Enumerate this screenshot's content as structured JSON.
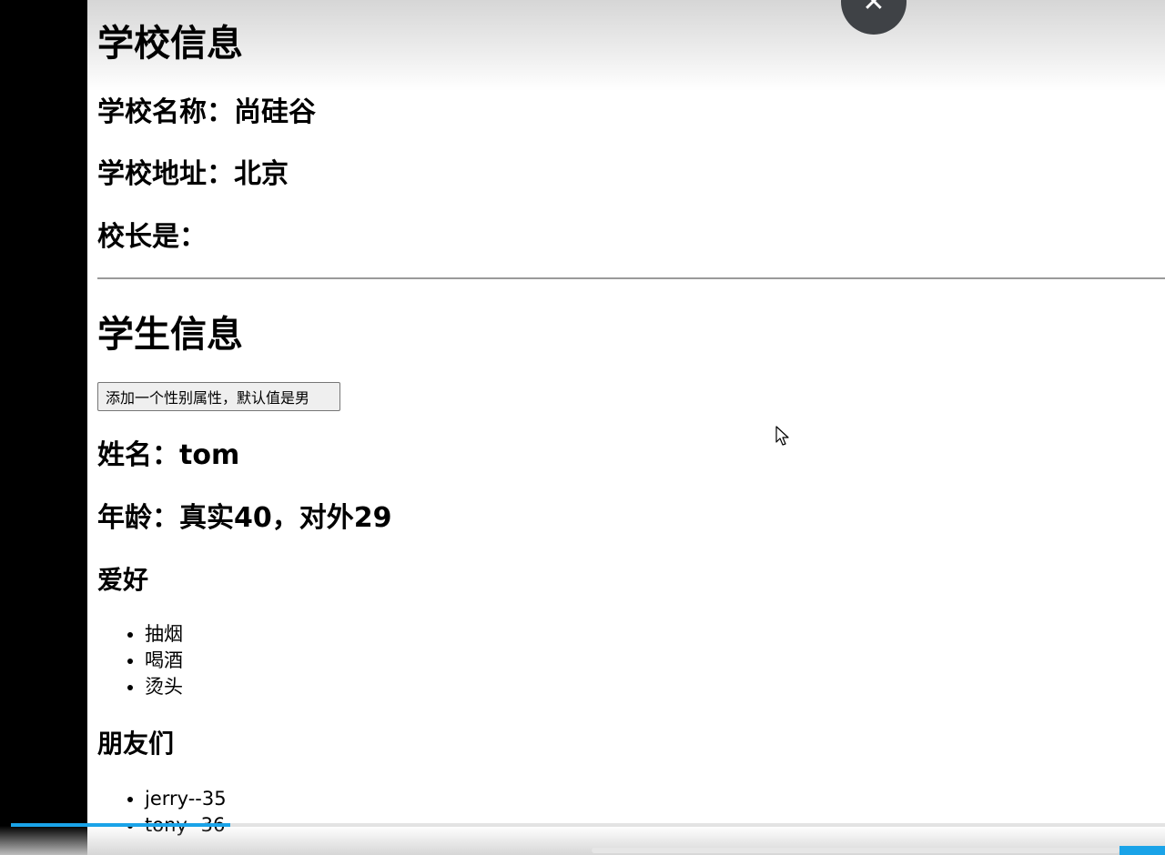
{
  "school": {
    "heading": "学校信息",
    "name_line": "学校名称：尚硅谷",
    "address_line": "学校地址：北京",
    "principal_line": "校长是："
  },
  "student": {
    "heading": "学生信息",
    "add_sex_button": "添加一个性别属性，默认值是男",
    "name_line": "姓名：tom",
    "age_line": "年龄：真实40，对外29",
    "hobbies_heading": "爱好",
    "hobbies": [
      "抽烟",
      "喝酒",
      "烫头"
    ],
    "friends_heading": "朋友们",
    "friends": [
      "jerry--35",
      "tony--36"
    ]
  },
  "player": {
    "close_glyph": "✕",
    "progress": 0.19
  },
  "colors": {
    "accent": "#1aa3e8",
    "close_bg": "#3f4246"
  }
}
